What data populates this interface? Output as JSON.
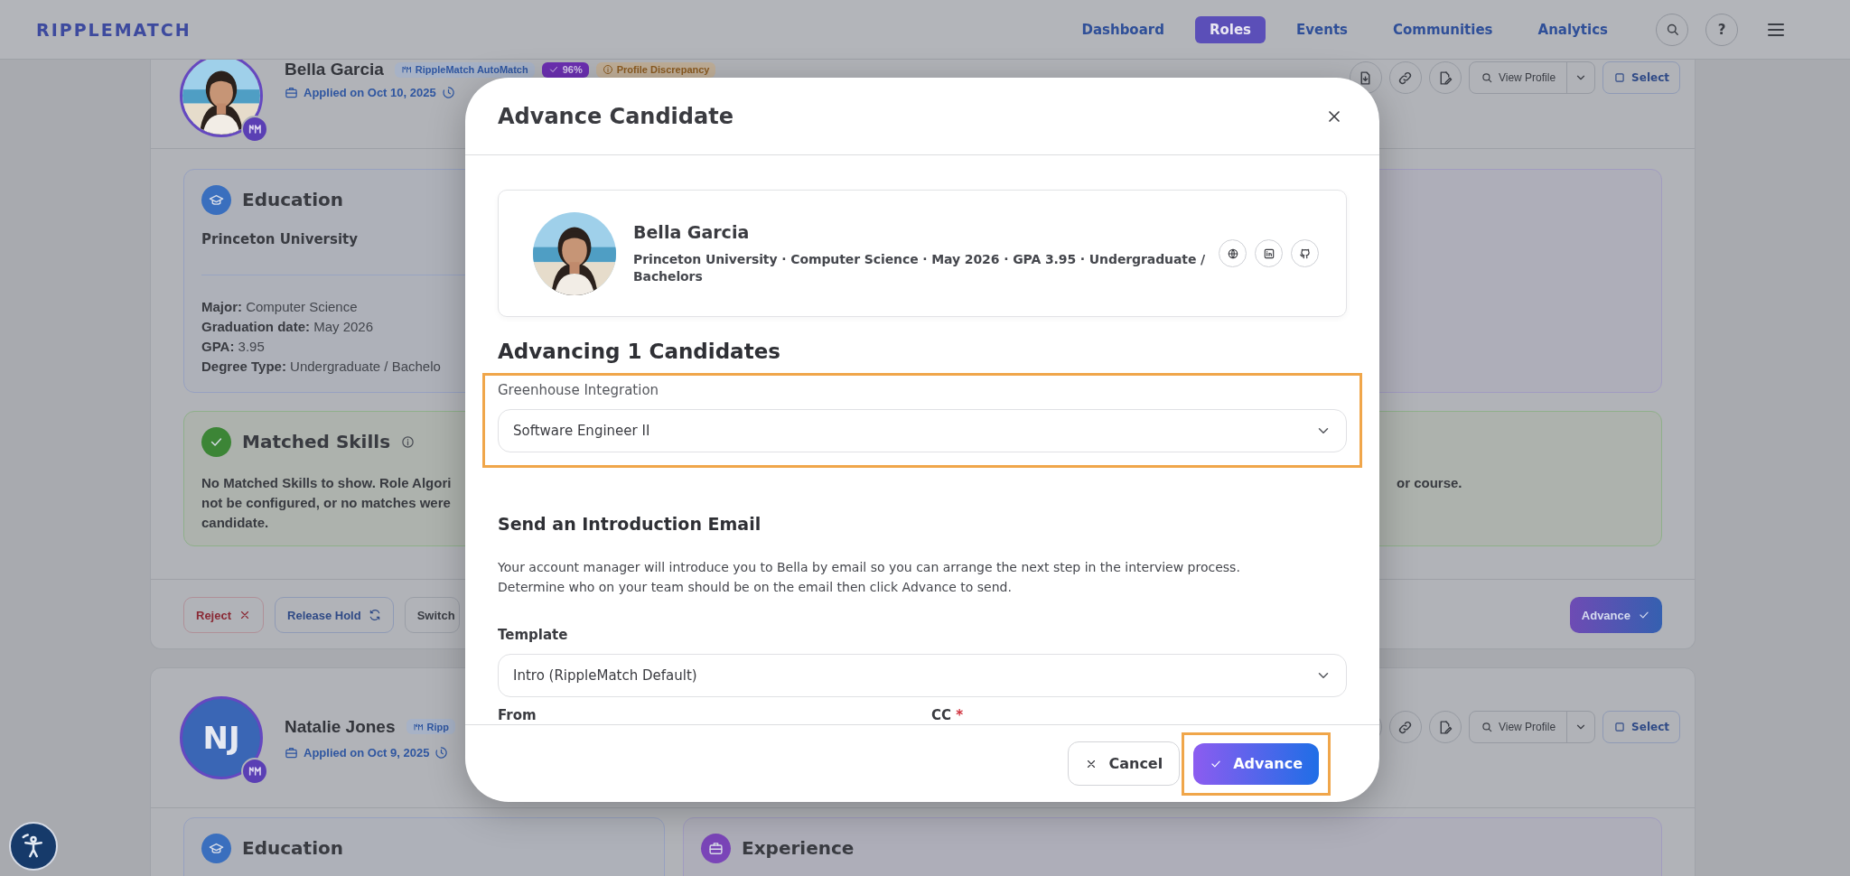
{
  "header": {
    "logo": "RIPPLEMATCH",
    "help_label": "?",
    "nav": [
      {
        "label": "Dashboard",
        "selected": false
      },
      {
        "label": "Roles",
        "selected": true
      },
      {
        "label": "Events",
        "selected": false
      },
      {
        "label": "Communities",
        "selected": false
      },
      {
        "label": "Analytics",
        "selected": false
      }
    ]
  },
  "candidates": [
    {
      "name": "Bella Garcia",
      "avatar": {
        "kind": "picture"
      },
      "badges": [
        {
          "kind": "source",
          "label": "RippleMatch AutoMatch"
        },
        {
          "kind": "score",
          "label": "96%"
        },
        {
          "kind": "warning",
          "label": "Profile Discrepancy"
        }
      ],
      "applied": "Applied on Oct 10, 2025",
      "view_profile": "View Profile",
      "select": "Select",
      "education": {
        "title": "Education",
        "school": "Princeton University",
        "fields": [
          {
            "label": "Major:",
            "value": "Computer Science"
          },
          {
            "label": "Graduation date:",
            "value": "May 2026"
          },
          {
            "label": "GPA:",
            "value": "3.95"
          },
          {
            "label": "Degree Type:",
            "value": "Undergraduate / Bachelo"
          }
        ]
      },
      "matched_skills": {
        "title": "Matched Skills",
        "lines": [
          "No Matched Skills to show. Role Algori",
          "not be configured, or no matches were",
          "candidate."
        ],
        "line_end": "or course."
      },
      "actions": [
        {
          "kind": "reject",
          "label": "Reject"
        },
        {
          "kind": "hold",
          "label": "Release Hold"
        },
        {
          "kind": "plain",
          "label": "Switch"
        }
      ],
      "advance": "Advance"
    },
    {
      "name": "Natalie Jones",
      "avatar": {
        "kind": "initials",
        "initials": "NJ"
      },
      "badges": [
        {
          "kind": "source",
          "label": "Ripp"
        }
      ],
      "applied": "Applied on Oct 9, 2025",
      "view_profile": "View Profile",
      "select": "Select",
      "education": {
        "title": "Education"
      },
      "experience": {
        "title": "Experience"
      }
    }
  ],
  "modal": {
    "title": "Advance Candidate",
    "candidate": {
      "name": "Bella Garcia",
      "details": "Princeton University · Computer Science · May 2026 · GPA 3.95 · Undergraduate / Bachelors"
    },
    "heading": "Advancing 1 Candidates",
    "integration": {
      "label": "Greenhouse Integration",
      "value": "Software Engineer II",
      "highlighted": true
    },
    "email": {
      "title": "Send an Introduction Email",
      "description": "Your account manager will introduce you to Bella by email so you can arrange the next step in the interview process. Determine who on your team should be on the email then click Advance to send.",
      "template_label": "Template",
      "template_value": "Intro (RippleMatch Default)",
      "from_label": "From",
      "cc_label": "CC",
      "cc_required_mark": "*"
    },
    "cancel": "Cancel",
    "advance": {
      "label": "Advance",
      "highlighted": true
    }
  }
}
